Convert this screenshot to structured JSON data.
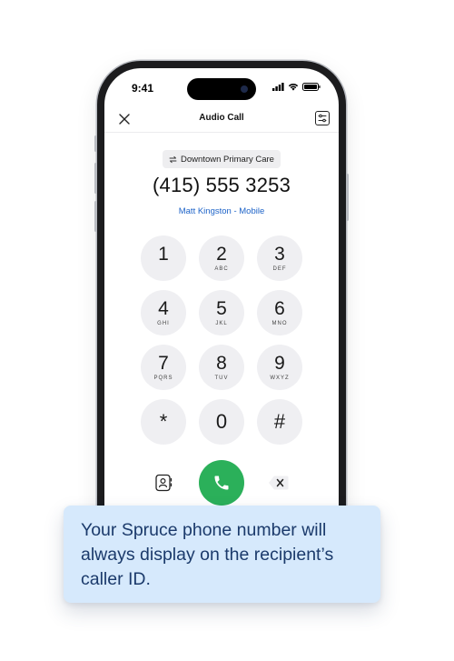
{
  "status_bar": {
    "time": "9:41"
  },
  "nav": {
    "title": "Audio Call",
    "close_icon": "close-icon",
    "settings_icon": "settings-sliders-icon"
  },
  "caller": {
    "location_icon": "swap-arrows-icon",
    "location": "Downtown Primary Care",
    "phone_number": "(415) 555 3253",
    "contact": "Matt Kingston - Mobile"
  },
  "keypad": [
    {
      "digit": "1",
      "letters": ""
    },
    {
      "digit": "2",
      "letters": "ABC"
    },
    {
      "digit": "3",
      "letters": "DEF"
    },
    {
      "digit": "4",
      "letters": "GHI"
    },
    {
      "digit": "5",
      "letters": "JKL"
    },
    {
      "digit": "6",
      "letters": "MNO"
    },
    {
      "digit": "7",
      "letters": "PQRS"
    },
    {
      "digit": "8",
      "letters": "TUV"
    },
    {
      "digit": "9",
      "letters": "WXYZ"
    },
    {
      "digit": "*",
      "letters": ""
    },
    {
      "digit": "0",
      "letters": ""
    },
    {
      "digit": "#",
      "letters": ""
    }
  ],
  "actions": {
    "contacts_icon": "contacts-book-icon",
    "call_icon": "phone-icon",
    "delete_icon": "backspace-icon",
    "call_color": "#2bb05a"
  },
  "tooltip": {
    "text": "Your Spruce phone number will always display on the recipient’s caller ID.",
    "background": "#d6e9fc",
    "text_color": "#1b3a6b"
  },
  "colors": {
    "link": "#1d63c8",
    "key_background": "#efeff2"
  }
}
